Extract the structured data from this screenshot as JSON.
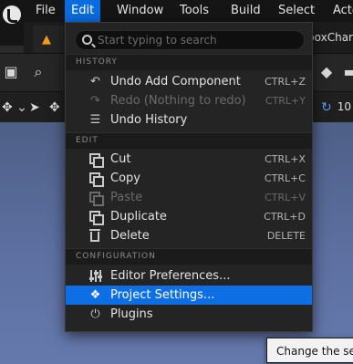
{
  "menubar": {
    "items": [
      "File",
      "Edit",
      "Window",
      "Tools",
      "Build",
      "Select",
      "Acto"
    ],
    "active": "Edit"
  },
  "tab": {
    "title": "boxChar"
  },
  "toolbar": {
    "right_value": "10"
  },
  "edit_menu": {
    "search": {
      "placeholder": "Start typing to search",
      "value": ""
    },
    "sections": {
      "history": "HISTORY",
      "edit": "EDIT",
      "configuration": "CONFIGURATION"
    },
    "history_items": [
      {
        "label": "Undo Add Component",
        "shortcut": "CTRL+Z",
        "icon": "undo-icon",
        "enabled": true
      },
      {
        "label": "Redo (Nothing to redo)",
        "shortcut": "CTRL+Y",
        "icon": "redo-icon",
        "enabled": false
      },
      {
        "label": "Undo History",
        "shortcut": "",
        "icon": "history-icon",
        "enabled": true
      }
    ],
    "edit_items": [
      {
        "label": "Cut",
        "shortcut": "CTRL+X",
        "icon": "cut-icon",
        "enabled": true
      },
      {
        "label": "Copy",
        "shortcut": "CTRL+C",
        "icon": "copy-icon",
        "enabled": true
      },
      {
        "label": "Paste",
        "shortcut": "CTRL+V",
        "icon": "paste-icon",
        "enabled": false
      },
      {
        "label": "Duplicate",
        "shortcut": "CTRL+D",
        "icon": "duplicate-icon",
        "enabled": true
      },
      {
        "label": "Delete",
        "shortcut": "DELETE",
        "icon": "trash-icon",
        "enabled": true
      }
    ],
    "config_items": [
      {
        "label": "Editor Preferences...",
        "icon": "sliders-icon"
      },
      {
        "label": "Project Settings...",
        "icon": "cube-icon",
        "highlighted": true
      },
      {
        "label": "Plugins",
        "icon": "plug-icon"
      }
    ]
  },
  "tooltip": {
    "text": "Change the sett"
  },
  "colors": {
    "accent": "#0d6fe3",
    "menu_bg": "#242424",
    "viewport": "#5d70a1"
  }
}
